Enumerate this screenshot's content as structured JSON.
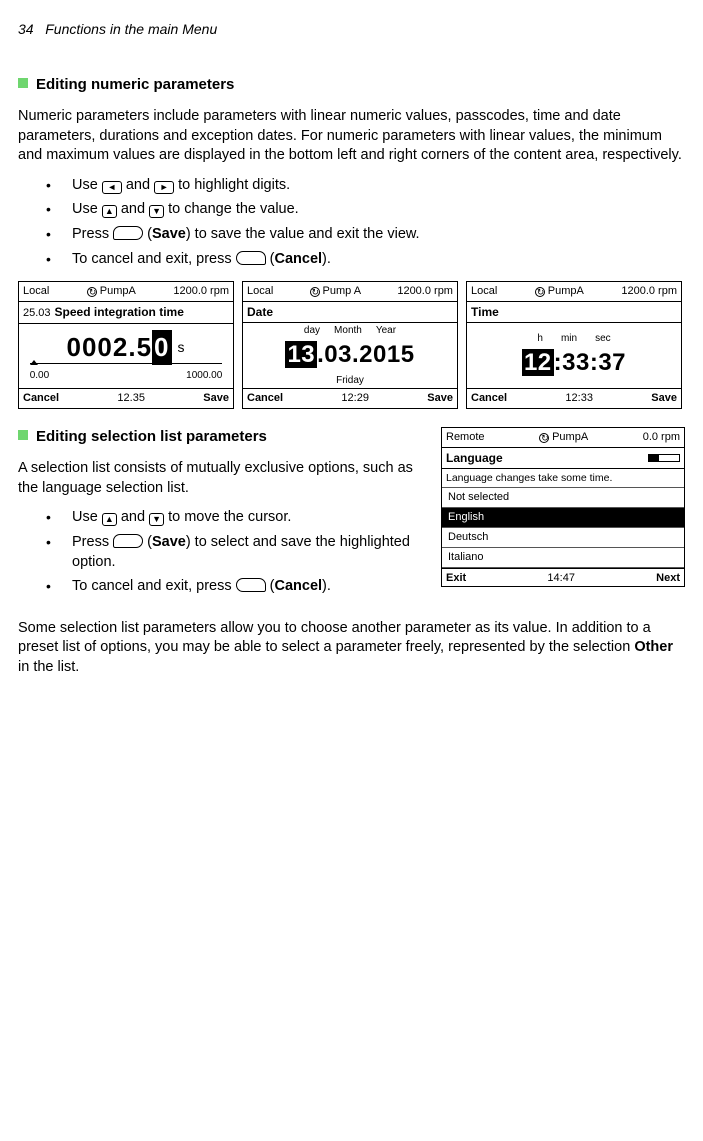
{
  "header": {
    "page_num": "34",
    "chapter": "Functions in the main Menu"
  },
  "section1": {
    "title": "Editing numeric parameters",
    "para": "Numeric parameters include parameters with linear numeric values, passcodes, time and date parameters, durations and exception dates. For numeric parameters with linear values, the minimum and maximum values are displayed in the bottom left and right corners of the content area, respectively.",
    "b1a": "Use ",
    "b1b": " and ",
    "b1c": " to highlight digits.",
    "b2a": "Use ",
    "b2b": " and ",
    "b2c": " to change the value.",
    "b3a": "Press ",
    "b3b": " (",
    "b3c": "Save",
    "b3d": ") to save the value and exit the view.",
    "b4a": "To cancel and exit, press ",
    "b4b": " (",
    "b4c": "Cancel",
    "b4d": ")."
  },
  "screen1": {
    "mode": "Local",
    "device": "PumpA",
    "speed": "1200.0 rpm",
    "title_idx": "25.03",
    "title": "Speed integration time",
    "val_pre": "0002.5",
    "val_hl": "0",
    "unit": "s",
    "min": "0.00",
    "max": "1000.00",
    "cancel": "Cancel",
    "time": "12.35",
    "save": "Save"
  },
  "screen2": {
    "mode": "Local",
    "device": "Pump A",
    "speed": "1200.0 rpm",
    "title": "Date",
    "lbl_day": "day",
    "lbl_month": "Month",
    "lbl_year": "Year",
    "val_hl": "13",
    "val_rest": ".03.2015",
    "dow": "Friday",
    "cancel": "Cancel",
    "time": "12:29",
    "save": "Save"
  },
  "screen3": {
    "mode": "Local",
    "device": "PumpA",
    "speed": "1200.0 rpm",
    "title": "Time",
    "lbl_h": "h",
    "lbl_min": "min",
    "lbl_sec": "sec",
    "val_hl": "12",
    "val_rest": ":33:37",
    "cancel": "Cancel",
    "time": "12:33",
    "save": "Save"
  },
  "section2": {
    "title": "Editing selection list parameters",
    "para": "A selection list consists of mutually exclusive options, such as the language selection list.",
    "b1a": "Use ",
    "b1b": " and ",
    "b1c": " to move the cursor.",
    "b2a": "Press ",
    "b2b": " (",
    "b2c": "Save",
    "b2d": ") to select and save the highlighted option.",
    "b3a": "To cancel and exit, press ",
    "b3b": " (",
    "b3c": "Cancel",
    "b3d": ").",
    "para2a": "Some selection list parameters allow you to choose another parameter as its value. In addition to a preset list of options, you may be able to select a parameter freely, represented by the selection ",
    "para2b": "Other",
    "para2c": " in the list."
  },
  "screen4": {
    "mode": "Remote",
    "device": "PumpA",
    "speed": "0.0 rpm",
    "title": "Language",
    "help": "Language changes take some time.",
    "opt0": "Not selected",
    "opt1": "English",
    "opt2": "Deutsch",
    "opt3": "Italiano",
    "exit": "Exit",
    "time": "14:47",
    "next": "Next"
  }
}
